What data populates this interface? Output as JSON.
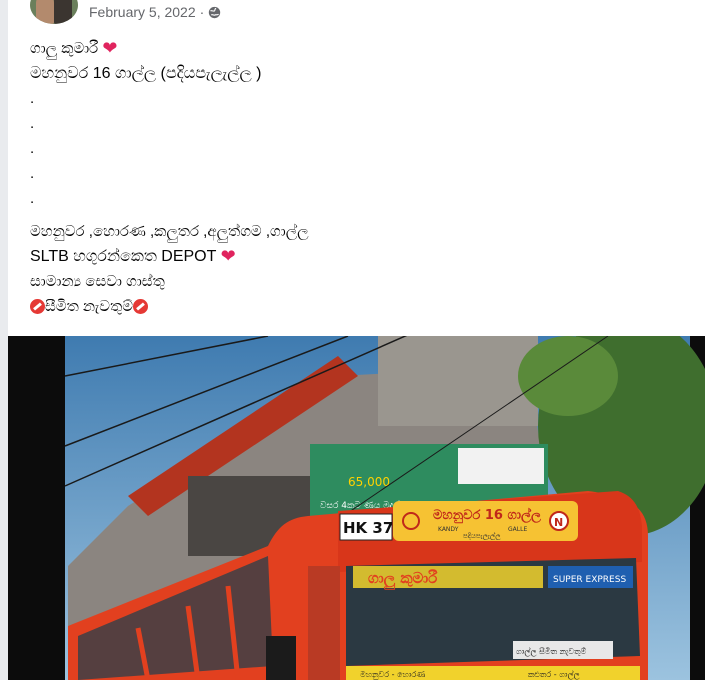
{
  "post": {
    "date": "February 5, 2022",
    "separator": "·",
    "privacy_icon": "globe-icon",
    "lines": [
      "ගාලු කුමාරී",
      "මහනුවර 16 ගාල්ල (පදියපැලැල්ල )",
      ".",
      ".",
      ".",
      ".",
      ".",
      "මහනුවර ,හොරණ ,කලුතර ,අලුත්ගම ,ගාල්ල",
      "SLTB  හගුරන්කෙත DEPOT",
      "සාමාන්‍ය සෙවා ගාස්තු",
      "සීමිත නැවතුම්"
    ],
    "emoji": {
      "heart": "❤",
      "heart_color": "#e0245e",
      "no_entry": "no-entry-icon"
    }
  },
  "photo": {
    "bus_route_code": "HK 37",
    "bus_destination": "මහනුවර 16 ගාල්ල",
    "bus_small_left": "KANDY",
    "bus_small_right": "GALLE",
    "bus_sub": "පදියපැලැල්ල",
    "bus_name": "ගාලු කුමාරී",
    "bus_tag": "SUPER EXPRESS",
    "bus_badge": "N",
    "bus_route_bottom_left": "මහනුවර - හොරණ",
    "bus_route_bottom_right": "කළුතර - ගාල්ල",
    "bus_window_sign": "ගාල්ල සීමිත නැවතුම්",
    "billboard_price": "65,000",
    "billboard_text": "වසර 4කට ණය මුදල්",
    "colors": {
      "bus": "#e2401f",
      "sky": "#4d86b8",
      "building": "#8b8580"
    }
  }
}
